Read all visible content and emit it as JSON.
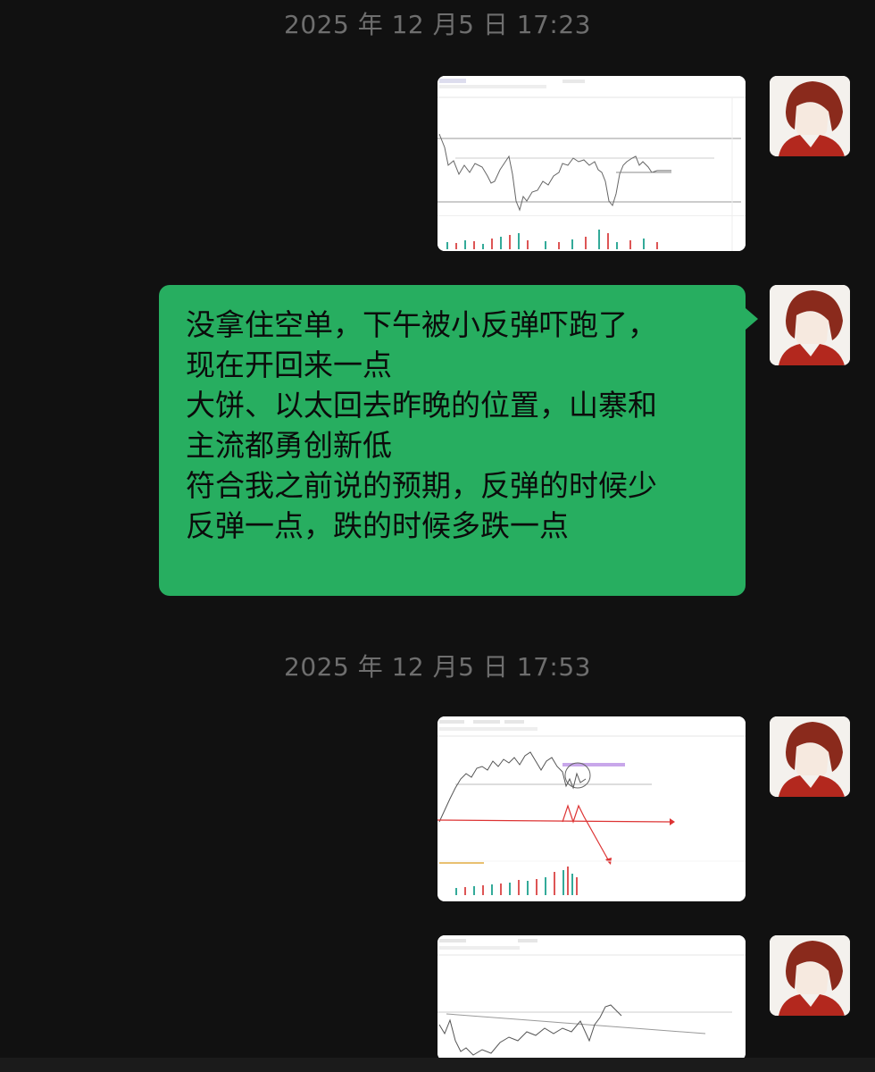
{
  "conversation": {
    "timestamps": [
      "2025 年 12 月5 日 17:23",
      "2025 年 12 月5 日 17:53"
    ],
    "text_message": {
      "lines": [
        "没拿住空单，下午被小反弹吓跑了，",
        "现在开回来一点",
        "大饼、以太回去昨晚的位置，山寨和",
        "主流都勇创新低",
        "符合我之前说的预期，反弹的时候少",
        "反弹一点，跌的时候多跌一点"
      ]
    },
    "image_messages": [
      {
        "content": "chart-screenshot-1"
      },
      {
        "content": "chart-screenshot-2"
      },
      {
        "content": "chart-screenshot-3"
      }
    ],
    "sender_avatar": "avatar-anime-boy-red-hair",
    "colors": {
      "background": "#111111",
      "bubble": "#27ae60",
      "timestamp": "#6e6e6e"
    }
  }
}
